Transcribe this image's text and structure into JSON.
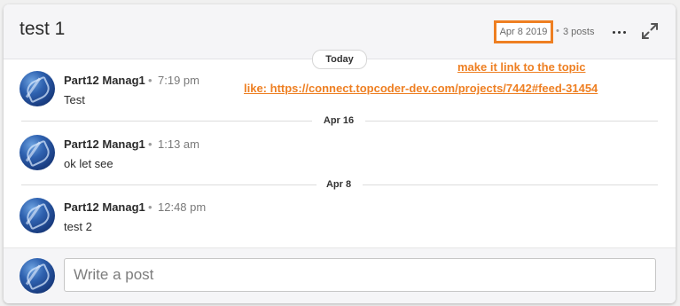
{
  "header": {
    "title": "test 1",
    "date": "Apr 8 2019",
    "separator": "•",
    "posts_count": "3 posts",
    "more_icon": "more-horizontal-icon",
    "expand_icon": "expand-icon"
  },
  "annotation": {
    "line1": "make it link to the topic",
    "line2": "like: https://connect.topcoder-dev.com/projects/7442#feed-31454",
    "color": "#ee7f22"
  },
  "feed": {
    "today_label": "Today",
    "posts": [
      {
        "author": "Part12 Manag1",
        "separator": "•",
        "time": "7:19 pm",
        "text": "Test"
      },
      {
        "author": "Part12 Manag1",
        "separator": "•",
        "time": "1:13 am",
        "text": "ok let see"
      },
      {
        "author": "Part12 Manag1",
        "separator": "•",
        "time": "12:48 pm",
        "text": "test 2"
      }
    ],
    "dividers": [
      "Apr 16",
      "Apr 8"
    ]
  },
  "composer": {
    "placeholder": "Write a post",
    "value": ""
  }
}
